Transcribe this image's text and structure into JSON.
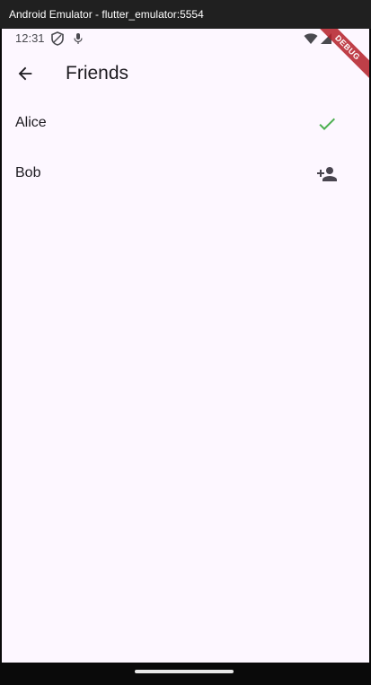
{
  "window": {
    "title": "Android Emulator - flutter_emulator:5554"
  },
  "status_bar": {
    "time": "12:31",
    "icons": [
      "shield-icon",
      "mic-icon",
      "wifi-icon",
      "signal-icon"
    ]
  },
  "debug_banner": "DEBUG",
  "app_bar": {
    "title": "Friends",
    "back_icon": "arrow-back-icon"
  },
  "friends": [
    {
      "name": "Alice",
      "status": "added",
      "icon": "check-icon",
      "icon_color": "#4caf50"
    },
    {
      "name": "Bob",
      "status": "not-added",
      "icon": "person-add-icon",
      "icon_color": "#49454f"
    }
  ],
  "colors": {
    "background": "#fdf7ff",
    "text": "#1d1b20",
    "check": "#4caf50",
    "debug": "#b41e28"
  }
}
